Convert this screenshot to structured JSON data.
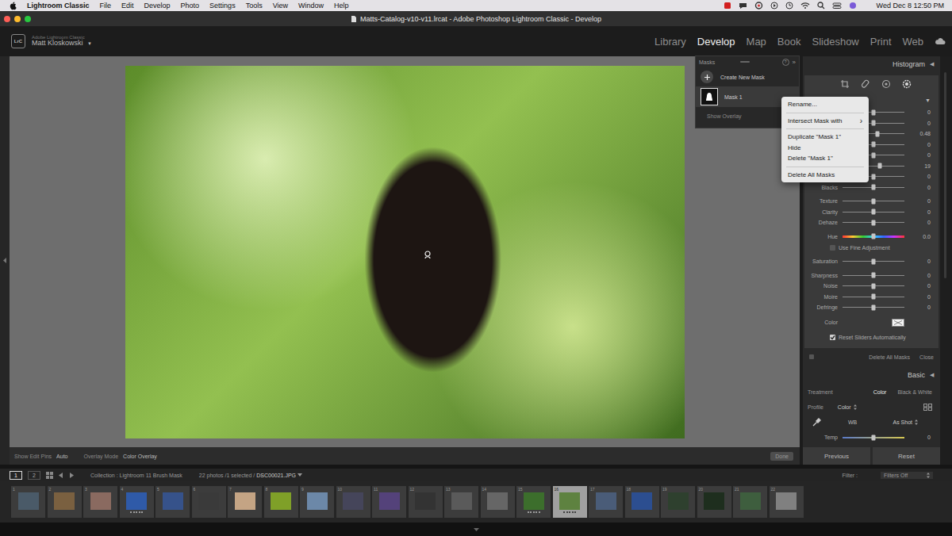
{
  "menubar": {
    "app": "Lightroom Classic",
    "items": [
      "File",
      "Edit",
      "Develop",
      "Photo",
      "Settings",
      "Tools",
      "View",
      "Window",
      "Help"
    ],
    "clock": "Wed Dec 8 12:50 PM"
  },
  "window": {
    "title": "Matts-Catalog-v10-v11.lrcat - Adobe Photoshop Lightroom Classic - Develop"
  },
  "identity": {
    "logo": "LrC",
    "product": "Adobe Lightroom Classic",
    "user": "Matt Kloskowski",
    "arrow": "▼"
  },
  "modules": [
    {
      "label": "Library",
      "selected": false
    },
    {
      "label": "Develop",
      "selected": true
    },
    {
      "label": "Map",
      "selected": false
    },
    {
      "label": "Book",
      "selected": false
    },
    {
      "label": "Slideshow",
      "selected": false
    },
    {
      "label": "Print",
      "selected": false
    },
    {
      "label": "Web",
      "selected": false
    }
  ],
  "masks_panel": {
    "title": "Masks",
    "help": "?",
    "collapse": "»",
    "create": "Create New Mask",
    "masks": [
      {
        "name": "Mask 1",
        "selected": true
      }
    ],
    "show_overlay": "Show Overlay"
  },
  "context_menu": [
    {
      "kind": "item",
      "label": "Rename..."
    },
    {
      "kind": "separator"
    },
    {
      "kind": "submenu",
      "label": "Intersect Mask with",
      "arrow": "›"
    },
    {
      "kind": "separator"
    },
    {
      "kind": "item",
      "label": "Duplicate \"Mask 1\""
    },
    {
      "kind": "item",
      "label": "Hide"
    },
    {
      "kind": "item",
      "label": "Delete \"Mask 1\""
    },
    {
      "kind": "separator"
    },
    {
      "kind": "item",
      "label": "Delete All Masks"
    }
  ],
  "right_panel": {
    "histogram": {
      "label": "Histogram",
      "arrow": "◀"
    },
    "mask_arrow": "▼",
    "groups": [
      [
        {
          "kind": "slider",
          "value": "0",
          "level": 0.5
        },
        {
          "kind": "slider",
          "value": "0",
          "level": 0.5
        },
        {
          "kind": "slider",
          "value": "0.48",
          "level": 0.57
        },
        {
          "kind": "slider",
          "value": "0",
          "level": 0.5
        },
        {
          "kind": "slider",
          "value": "0",
          "level": 0.5
        },
        {
          "kind": "slider",
          "value": "19",
          "level": 0.6
        },
        {
          "kind": "slider",
          "value": "0",
          "level": 0.5
        },
        {
          "kind": "slider",
          "label": "Blacks",
          "value": "0",
          "level": 0.5
        }
      ],
      [
        {
          "kind": "slider",
          "label": "Texture",
          "value": "0",
          "level": 0.5
        },
        {
          "kind": "slider",
          "label": "Clarity",
          "value": "0",
          "level": 0.5
        },
        {
          "kind": "slider",
          "label": "Dehaze",
          "value": "0",
          "level": 0.5
        }
      ],
      [
        {
          "kind": "hue",
          "label": "Hue",
          "value": "0.0",
          "level": 0.5
        },
        {
          "kind": "checkbox",
          "label": "Use Fine Adjustment",
          "checked": false
        }
      ],
      [
        {
          "kind": "slider",
          "label": "Saturation",
          "value": "0",
          "level": 0.5
        }
      ],
      [
        {
          "kind": "slider",
          "label": "Sharpness",
          "value": "0",
          "level": 0.5
        },
        {
          "kind": "slider",
          "label": "Noise",
          "value": "0",
          "level": 0.5
        },
        {
          "kind": "slider",
          "label": "Moire",
          "value": "0",
          "level": 0.5
        },
        {
          "kind": "slider",
          "label": "Defringe",
          "value": "0",
          "level": 0.5
        }
      ],
      [
        {
          "kind": "color",
          "label": "Color"
        }
      ],
      [
        {
          "kind": "checkbox",
          "label": "Reset Sliders Automatically",
          "checked": true
        }
      ]
    ],
    "footer": {
      "delete_all": "Delete All Masks",
      "close": "Close"
    }
  },
  "basic": {
    "title": "Basic",
    "arrow": "◀",
    "treatment_label": "Treatment",
    "treatments": [
      {
        "label": "Color",
        "selected": true
      },
      {
        "label": "Black & White",
        "selected": false
      }
    ],
    "profile_label": "Profile",
    "profile": "Color",
    "wb_label": "WB",
    "wb": "As Shot",
    "temp": {
      "label": "Temp",
      "value": "0",
      "level": 0.5
    }
  },
  "panel_buttons": [
    "Previous",
    "Reset"
  ],
  "toolbar": {
    "pins_label": "Show Edit Pins",
    "pins": "Auto",
    "overlay_label": "Overlay Mode",
    "overlay": "Color Overlay",
    "done": "Done"
  },
  "filmstrip": {
    "pages": [
      {
        "label": "1",
        "selected": true
      },
      {
        "label": "2",
        "selected": false
      }
    ],
    "collection": "Collection : Lightroom 11 Brush Mask",
    "count": "22 photos /1 selected /",
    "file": "DSC00021.JPG",
    "filter_label": "Filter :",
    "filter": "Filters Off",
    "thumbs": [
      {
        "number": "1",
        "selected": false,
        "stars": 0,
        "color": "#4a5a68"
      },
      {
        "number": "2",
        "selected": false,
        "stars": 0,
        "color": "#7a6040"
      },
      {
        "number": "3",
        "selected": false,
        "stars": 0,
        "color": "#8a6a60"
      },
      {
        "number": "4",
        "selected": false,
        "stars": 5,
        "color": "#2f5aa8"
      },
      {
        "number": "5",
        "selected": false,
        "stars": 0,
        "color": "#36528a"
      },
      {
        "number": "6",
        "selected": false,
        "stars": 0,
        "color": "#3a3a3a"
      },
      {
        "number": "7",
        "selected": false,
        "stars": 0,
        "color": "#c4a484"
      },
      {
        "number": "8",
        "selected": false,
        "stars": 0,
        "color": "#7fa028"
      },
      {
        "number": "9",
        "selected": false,
        "stars": 0,
        "color": "#6c88a8"
      },
      {
        "number": "10",
        "selected": false,
        "stars": 0,
        "color": "#45455a"
      },
      {
        "number": "11",
        "selected": false,
        "stars": 0,
        "color": "#54427a"
      },
      {
        "number": "12",
        "selected": false,
        "stars": 0,
        "color": "#333333"
      },
      {
        "number": "13",
        "selected": false,
        "stars": 0,
        "color": "#5a5a5a"
      },
      {
        "number": "14",
        "selected": false,
        "stars": 0,
        "color": "#666666"
      },
      {
        "number": "15",
        "selected": false,
        "stars": 5,
        "color": "#3c6e2c"
      },
      {
        "number": "16",
        "selected": true,
        "stars": 5,
        "color": "#5e8240"
      },
      {
        "number": "17",
        "selected": false,
        "stars": 0,
        "color": "#4a5c78"
      },
      {
        "number": "18",
        "selected": false,
        "stars": 0,
        "color": "#2c4e90"
      },
      {
        "number": "19",
        "selected": false,
        "stars": 0,
        "color": "#2e402e"
      },
      {
        "number": "20",
        "selected": false,
        "stars": 0,
        "color": "#1e2e1e"
      },
      {
        "number": "21",
        "selected": false,
        "stars": 0,
        "color": "#3e5e3e"
      },
      {
        "number": "22",
        "selected": false,
        "stars": 0,
        "color": "#808080"
      }
    ]
  }
}
